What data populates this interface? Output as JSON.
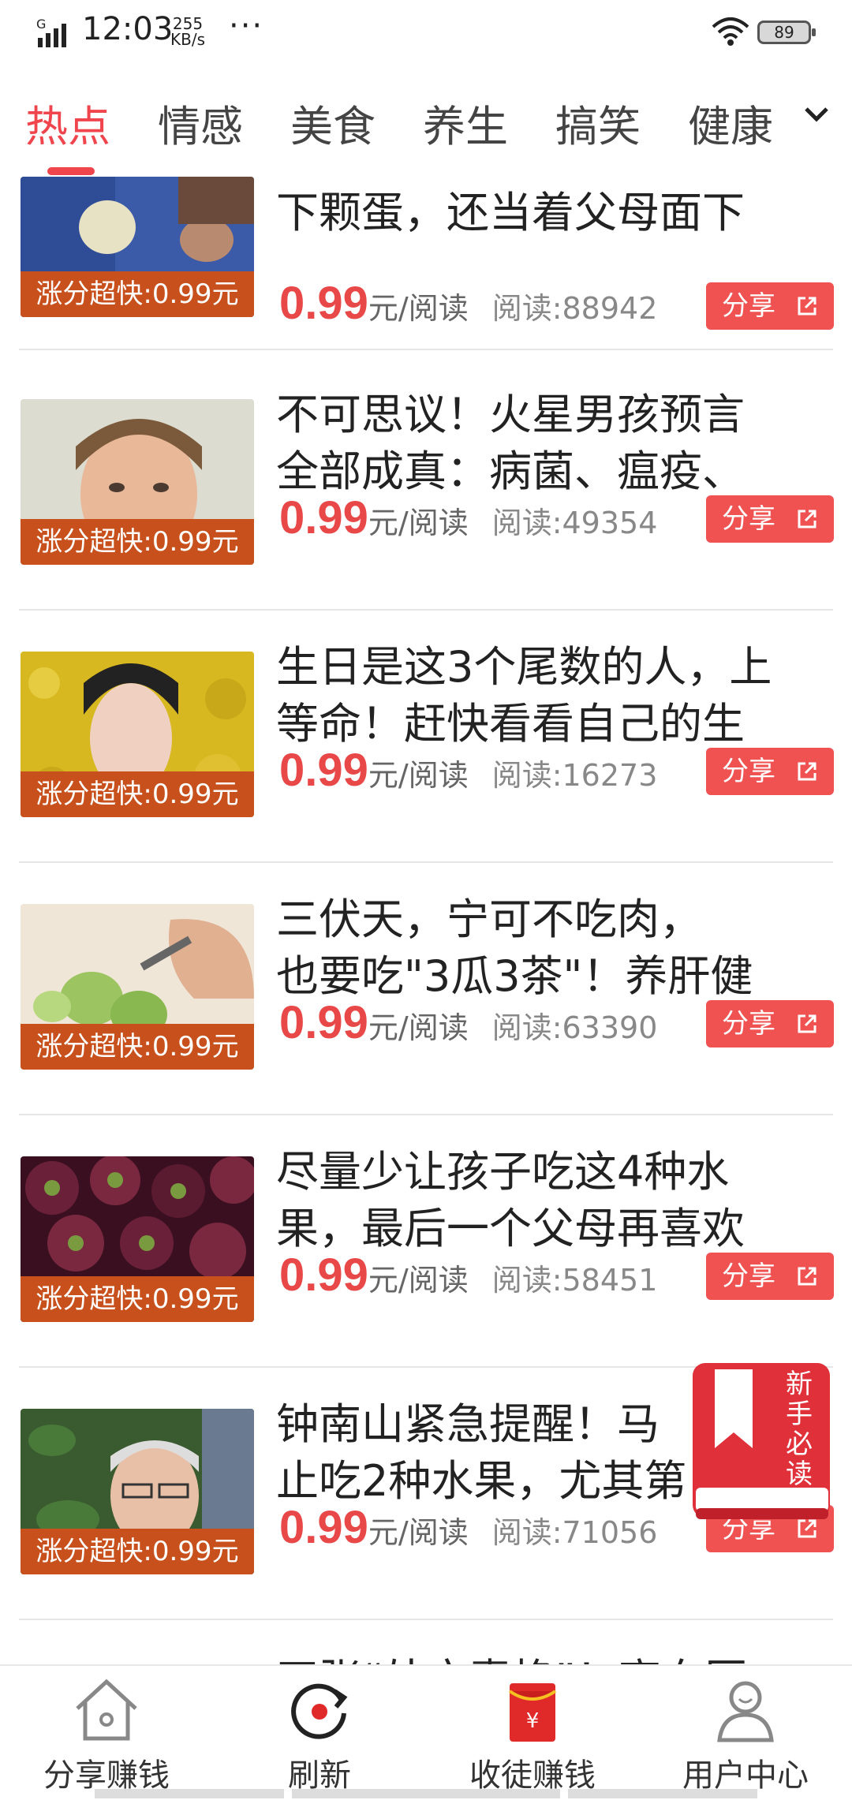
{
  "status_bar": {
    "network": "G",
    "time": "12:03",
    "speed_value": "255",
    "speed_unit": "KB/s",
    "more": "···",
    "battery": "89"
  },
  "tabs": [
    {
      "label": "热点",
      "active": true
    },
    {
      "label": "情感"
    },
    {
      "label": "美食"
    },
    {
      "label": "养生"
    },
    {
      "label": "搞笑"
    },
    {
      "label": "健康"
    }
  ],
  "articles": [
    {
      "title_lines": [
        "下颗蛋，还当着父母面下"
      ],
      "badge": "涨分超快:0.99元",
      "price": "0.99",
      "price_unit": "元/阅读",
      "reads": "阅读:88942",
      "share": "分享"
    },
    {
      "title_lines": [
        "不可思议！火星男孩预言",
        "全部成真：病菌、瘟疫、"
      ],
      "badge": "涨分超快:0.99元",
      "price": "0.99",
      "price_unit": "元/阅读",
      "reads": "阅读:49354",
      "share": "分享"
    },
    {
      "title_lines": [
        "生日是这3个尾数的人，上",
        "等命！赶快看看自己的生"
      ],
      "badge": "涨分超快:0.99元",
      "price": "0.99",
      "price_unit": "元/阅读",
      "reads": "阅读:16273",
      "share": "分享"
    },
    {
      "title_lines": [
        "三伏天，宁可不吃肉，",
        "也要吃\"3瓜3茶\"！养肝健"
      ],
      "badge": "涨分超快:0.99元",
      "price": "0.99",
      "price_unit": "元/阅读",
      "reads": "阅读:63390",
      "share": "分享"
    },
    {
      "title_lines": [
        "尽量少让孩子吃这4种水",
        "果，最后一个父母再喜欢"
      ],
      "badge": "涨分超快:0.99元",
      "price": "0.99",
      "price_unit": "元/阅读",
      "reads": "阅读:58451",
      "share": "分享"
    },
    {
      "title_lines": [
        "钟南山紧急提醒！马",
        "止吃2种水果，尤其第"
      ],
      "badge": "涨分超快:0.99元",
      "price": "0.99",
      "price_unit": "元/阅读",
      "reads": "阅读:71056",
      "share": "分享"
    },
    {
      "title_lines": [
        "四张“处方素格”！高血压"
      ]
    }
  ],
  "guide_badge": {
    "text": [
      "新",
      "手",
      "必",
      "读"
    ]
  },
  "bottom_nav": [
    {
      "label": "分享赚钱",
      "icon": "home-icon"
    },
    {
      "label": "刷新",
      "icon": "refresh-icon"
    },
    {
      "label": "收徒赚钱",
      "icon": "red-envelope-icon",
      "symbol": "¥"
    },
    {
      "label": "用户中心",
      "icon": "user-icon"
    }
  ],
  "colors": {
    "accent": "#f0454c",
    "badge": "#c8501c",
    "share": "#f05252"
  }
}
